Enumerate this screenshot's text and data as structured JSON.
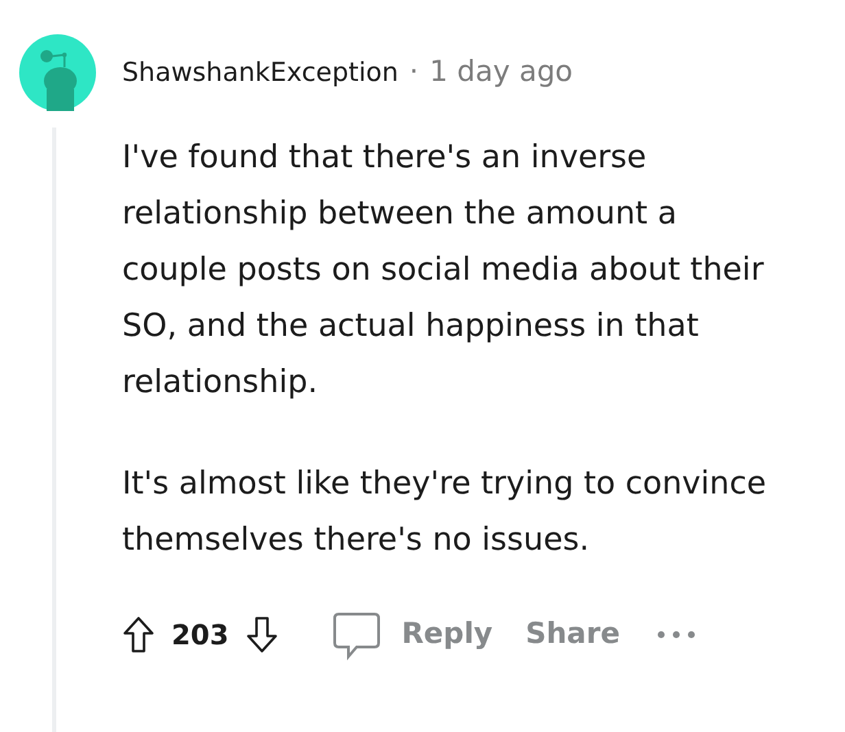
{
  "comment": {
    "author": "ShawshankException",
    "separator": "·",
    "time": "1 day ago",
    "paragraphs": [
      "I've found that there's an inverse relationship between the amount a couple posts on social media about their SO, and the actual happiness in that relationship.",
      "It's almost like they're trying to convince themselves there's no issues."
    ],
    "score": "203",
    "actions": [
      "Reply",
      "Share"
    ]
  }
}
